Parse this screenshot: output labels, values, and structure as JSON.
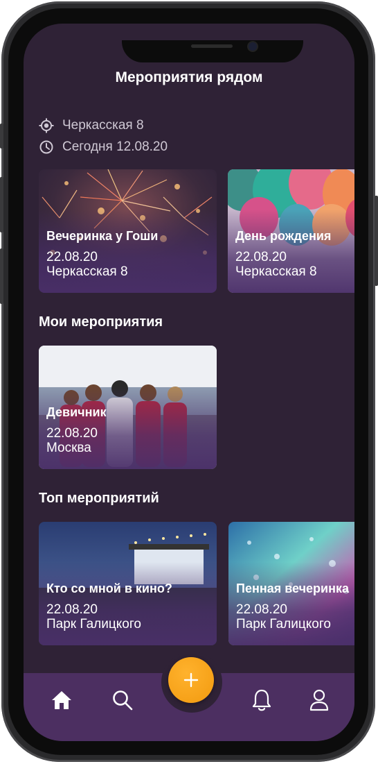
{
  "header": {
    "title": "Мероприятия рядом"
  },
  "location": {
    "address": "Черкасская 8",
    "date": "Сегодня 12.08.20"
  },
  "nearby": [
    {
      "title": "Вечеринка у Гоши",
      "date": "22.08.20",
      "place": "Черкасская 8",
      "image": "fireworks"
    },
    {
      "title": "День рождения",
      "date": "22.08.20",
      "place": "Черкасская 8",
      "image": "balloons"
    }
  ],
  "my_events": {
    "heading": "Мои мероприятия",
    "items": [
      {
        "title": "Девичник",
        "date": "22.08.20",
        "place": "Москва",
        "image": "women-seaside"
      }
    ]
  },
  "top_events": {
    "heading": "Топ мероприятий",
    "items": [
      {
        "title": "Кто со мной в кино?",
        "date": "22.08.20",
        "place": "Парк Галицкого",
        "image": "open-air-cinema"
      },
      {
        "title": "Пенная вечеринка",
        "date": "22.08.20",
        "place": "Парк Галицкого",
        "image": "foam-party"
      }
    ]
  },
  "tabbar": {
    "icons": [
      "home-icon",
      "search-icon",
      "plus-icon",
      "bell-icon",
      "user-icon"
    ]
  },
  "colors": {
    "background": "#2f2236",
    "tabbar": "#4c2f61",
    "accent": "#f7a11a",
    "text": "#ffffff"
  }
}
